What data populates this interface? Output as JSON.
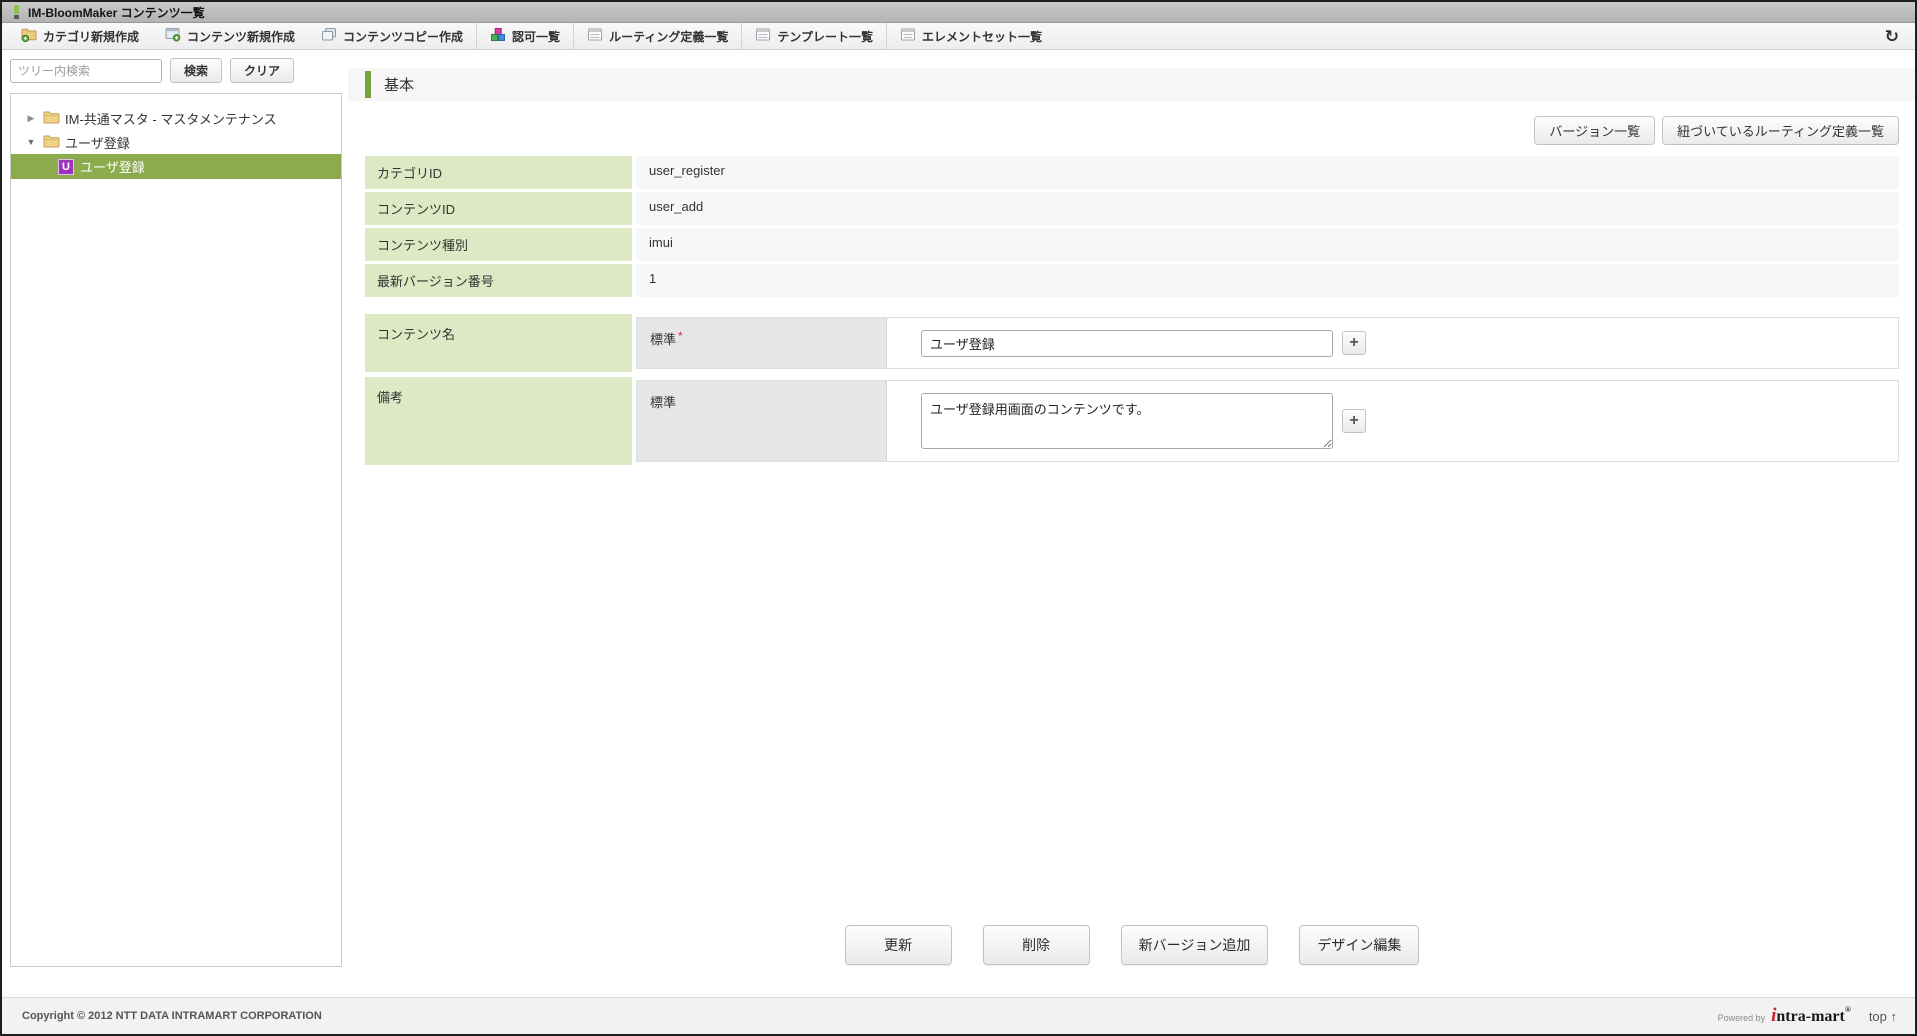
{
  "titlebar": {
    "title": "IM-BloomMaker コンテンツ一覧"
  },
  "toolbar": {
    "items": [
      {
        "label": "カテゴリ新規作成"
      },
      {
        "label": "コンテンツ新規作成"
      },
      {
        "label": "コンテンツコピー作成"
      },
      {
        "label": "認可一覧"
      },
      {
        "label": "ルーティング定義一覧"
      },
      {
        "label": "テンプレート一覧"
      },
      {
        "label": "エレメントセット一覧"
      }
    ],
    "refresh_glyph": "↻"
  },
  "sidebar": {
    "search_placeholder": "ツリー内検索",
    "search_button": "検索",
    "clear_button": "クリア",
    "tree": {
      "root1": {
        "label": "IM-共通マスタ - マスタメンテナンス",
        "state": "collapsed",
        "arrow": "▶"
      },
      "root2": {
        "label": "ユーザ登録",
        "state": "expanded",
        "arrow": "▼"
      },
      "child1": {
        "label": "ユーザ登録",
        "badge": "U",
        "selected": true
      }
    }
  },
  "main": {
    "section_title": "基本",
    "top_buttons": {
      "versions": "バージョン一覧",
      "linked_routing": "紐づいているルーティング定義一覧"
    },
    "info_rows": [
      {
        "label": "カテゴリID",
        "value": "user_register"
      },
      {
        "label": "コンテンツID",
        "value": "user_add"
      },
      {
        "label": "コンテンツ種別",
        "value": "imui"
      },
      {
        "label": "最新バージョン番号",
        "value": "1"
      }
    ],
    "name_row": {
      "label": "コンテンツ名",
      "sub_label": "標準",
      "required_mark": "*",
      "value": "ユーザ登録",
      "add_button": "+"
    },
    "note_row": {
      "label": "備考",
      "sub_label": "標準",
      "value": "ユーザ登録用画面のコンテンツです。",
      "add_button": "+"
    },
    "bottom_buttons": {
      "update": "更新",
      "delete": "削除",
      "add_version": "新バージョン追加",
      "design_edit": "デザイン編集"
    }
  },
  "footer": {
    "copyright": "Copyright © 2012 NTT DATA INTRAMART CORPORATION",
    "powered_by": "Powered by",
    "logo_i": "i",
    "logo_rest": "ntra-mart",
    "logo_mark": "®",
    "top_link": "top ↑"
  },
  "colors": {
    "selected_tree_row": "#8cab4c",
    "accent_green_bar": "#77a33c",
    "label_cell_green": "#dde8c4",
    "value_cell_gray": "#f7f7f7",
    "sub_label_gray": "#e6e6e6",
    "badge_purple": "#a032c0",
    "required_red": "#e0245e",
    "logo_red": "#cc2229"
  }
}
